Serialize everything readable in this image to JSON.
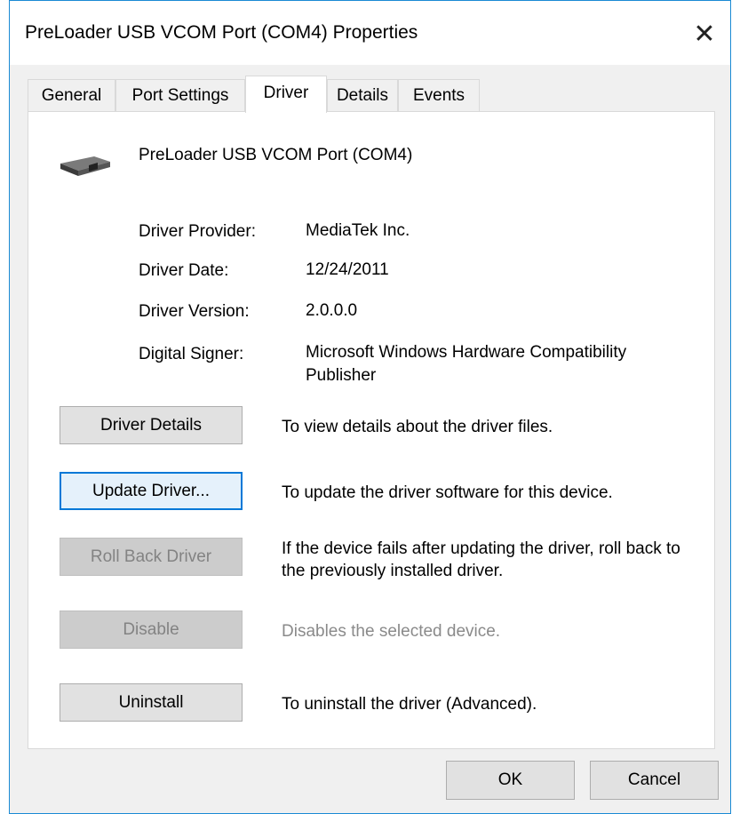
{
  "window": {
    "title": "PreLoader USB VCOM Port (COM4) Properties",
    "close_glyph": "✕"
  },
  "tabs": [
    {
      "label": "General",
      "active": false
    },
    {
      "label": "Port Settings",
      "active": false
    },
    {
      "label": "Driver",
      "active": true
    },
    {
      "label": "Details",
      "active": false
    },
    {
      "label": "Events",
      "active": false
    }
  ],
  "device": {
    "icon": "usb-port-icon",
    "name": "PreLoader USB VCOM Port (COM4)"
  },
  "info": [
    {
      "label": "Driver Provider:",
      "value": "MediaTek Inc."
    },
    {
      "label": "Driver Date:",
      "value": "12/24/2011"
    },
    {
      "label": "Driver Version:",
      "value": "2.0.0.0"
    },
    {
      "label": "Digital Signer:",
      "value": "Microsoft Windows Hardware Compatibility Publisher"
    }
  ],
  "actions": [
    {
      "label": "Driver Details",
      "desc": "To view details about the driver files.",
      "enabled": true
    },
    {
      "label": "Update Driver...",
      "desc": "To update the driver software for this device.",
      "enabled": true
    },
    {
      "label": "Roll Back Driver",
      "desc": "If the device fails after updating the driver, roll back to the previously installed driver.",
      "enabled": false
    },
    {
      "label": "Disable",
      "desc": "Disables the selected device.",
      "enabled": false
    },
    {
      "label": "Uninstall",
      "desc": "To uninstall the driver (Advanced).",
      "enabled": true
    }
  ],
  "footer": {
    "ok_label": "OK",
    "cancel_label": "Cancel"
  },
  "colors": {
    "accent": "#0078d7",
    "window_border": "#1a8ad4",
    "disabled_text": "#838383"
  }
}
